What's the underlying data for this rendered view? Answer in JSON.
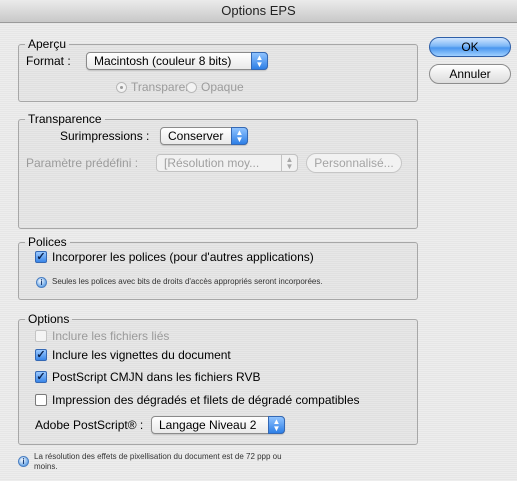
{
  "window": {
    "title": "Options EPS"
  },
  "buttons": {
    "ok": "OK",
    "cancel": "Annuler"
  },
  "apercu": {
    "legend": "Aperçu",
    "format_label": "Format :",
    "format_value": "Macintosh (couleur 8 bits)",
    "radio_transparent": "Transparent",
    "radio_opaque": "Opaque",
    "selected_radio": "Transparent"
  },
  "transparence": {
    "legend": "Transparence",
    "surimpressions_label": "Surimpressions :",
    "surimpressions_value": "Conserver",
    "preset_label": "Paramètre prédéfini :",
    "preset_value": "[Résolution moy...",
    "custom_button": "Personnalisé..."
  },
  "polices": {
    "legend": "Polices",
    "embed_fonts": {
      "label": "Incorporer les polices (pour d'autres applications)",
      "checked": true
    },
    "note": "Seules les polices avec bits de droits d'accès appropriés seront incorporées."
  },
  "options": {
    "legend": "Options",
    "linked_files": {
      "label": "Inclure les fichiers liés",
      "checked": false,
      "enabled": false
    },
    "thumbnails": {
      "label": "Inclure les vignettes du document",
      "checked": true
    },
    "cmyk": {
      "label": "PostScript CMJN dans les fichiers RVB",
      "checked": true
    },
    "gradients": {
      "label": "Impression des dégradés et filets de dégradé compatibles",
      "checked": false
    },
    "postscript_label": "Adobe PostScript® :",
    "postscript_value": "Langage Niveau 2"
  },
  "footer": {
    "note_line1": "La résolution des effets de pixellisation du document est de 72 ppp ou",
    "note_line2": "moins."
  }
}
